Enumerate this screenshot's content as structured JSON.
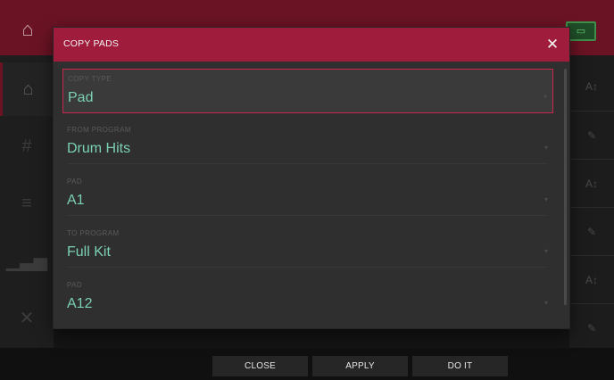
{
  "dialog": {
    "title": "COPY PADS",
    "close_icon": "close-icon",
    "fields": [
      {
        "label": "COPY TYPE",
        "value": "Pad",
        "selected": true
      },
      {
        "label": "FROM PROGRAM",
        "value": "Drum Hits",
        "selected": false
      },
      {
        "label": "PAD",
        "value": "A1",
        "selected": false
      },
      {
        "label": "TO PROGRAM",
        "value": "Full Kit",
        "selected": false
      },
      {
        "label": "PAD",
        "value": "A12",
        "selected": false
      }
    ]
  },
  "footer": {
    "close_label": "CLOSE",
    "apply_label": "APPLY",
    "doit_label": "DO IT"
  },
  "icons": {
    "home": "home-icon",
    "grid": "grid-icon",
    "bars": "bars-icon",
    "meter": "meter-icon",
    "xy": "xy-icon",
    "sort": "sort-icon",
    "edit": "pencil-icon"
  },
  "colors": {
    "header": "#a01c3c",
    "topbar": "#6a1324",
    "value_text": "#7bd0b3",
    "selected_border": "#c8284e"
  }
}
